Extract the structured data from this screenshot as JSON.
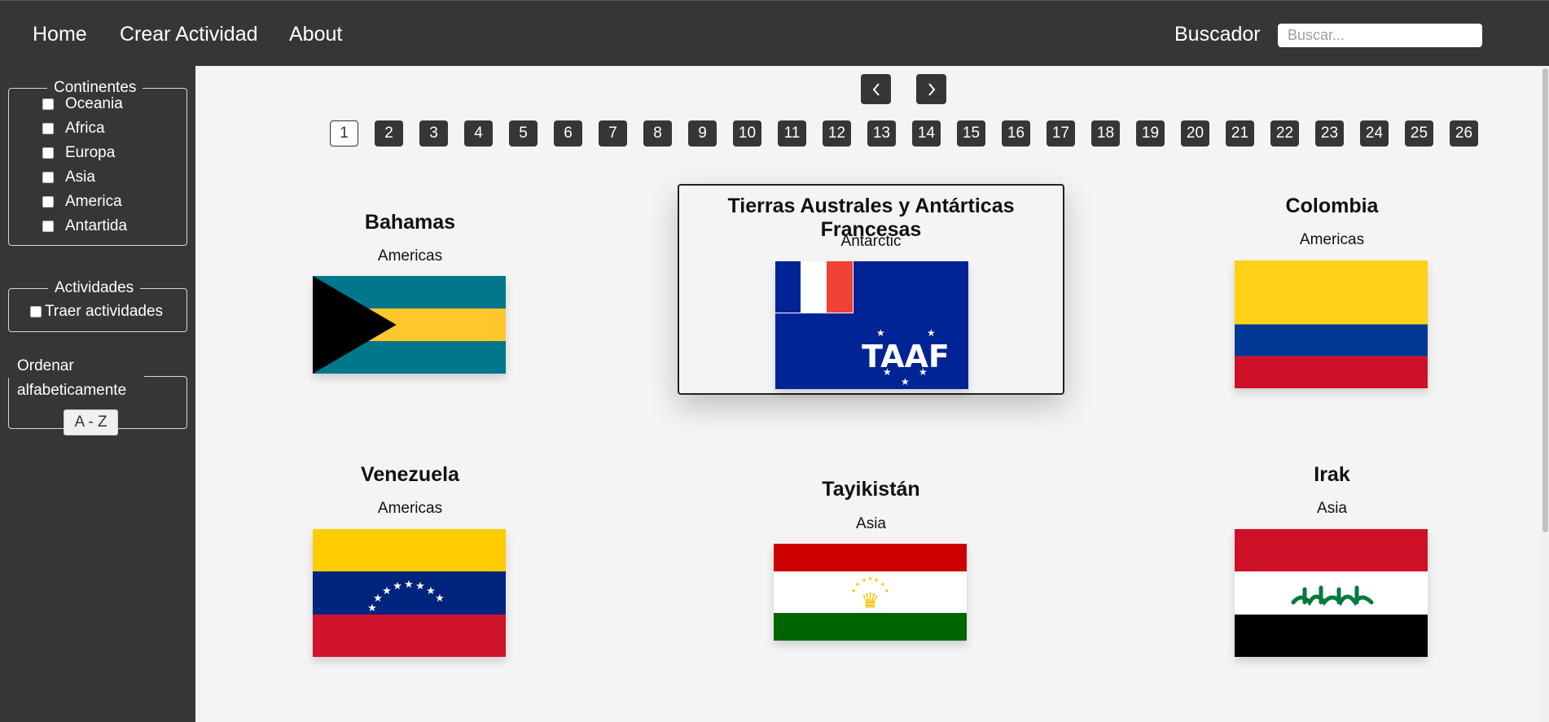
{
  "nav": {
    "home": "Home",
    "create_activity": "Crear Actividad",
    "about": "About",
    "search_label": "Buscador",
    "search_placeholder": "Buscar..."
  },
  "filters": {
    "continents_legend": "Continentes",
    "continents": [
      "Oceania",
      "Africa",
      "Europa",
      "Asia",
      "America",
      "Antartida"
    ],
    "activities_legend": "Actividades",
    "activities_checkbox": "Traer actividades",
    "sort_label_line1": "Ordenar",
    "sort_label_line2": "alfabeticamente",
    "sort_button": "A - Z"
  },
  "pagination": {
    "pages": [
      "1",
      "2",
      "3",
      "4",
      "5",
      "6",
      "7",
      "8",
      "9",
      "10",
      "11",
      "12",
      "13",
      "14",
      "15",
      "16",
      "17",
      "18",
      "19",
      "20",
      "21",
      "22",
      "23",
      "24",
      "25",
      "26"
    ],
    "current": "1"
  },
  "cards": [
    {
      "name": "Bahamas",
      "region": "Americas",
      "flag": "bahamas-flag"
    },
    {
      "name": "Tierras Australes y Antárticas Francesas",
      "region": "Antarctic",
      "flag": "french-southern-territories-flag"
    },
    {
      "name": "Colombia",
      "region": "Americas",
      "flag": "colombia-flag"
    },
    {
      "name": "Venezuela",
      "region": "Americas",
      "flag": "venezuela-flag"
    },
    {
      "name": "Tayikistán",
      "region": "Asia",
      "flag": "tajikistan-flag"
    },
    {
      "name": "Irak",
      "region": "Asia",
      "flag": "iraq-flag"
    }
  ],
  "colors": {
    "nav_bg": "#363636",
    "page_bg": "#f4f4f4"
  }
}
